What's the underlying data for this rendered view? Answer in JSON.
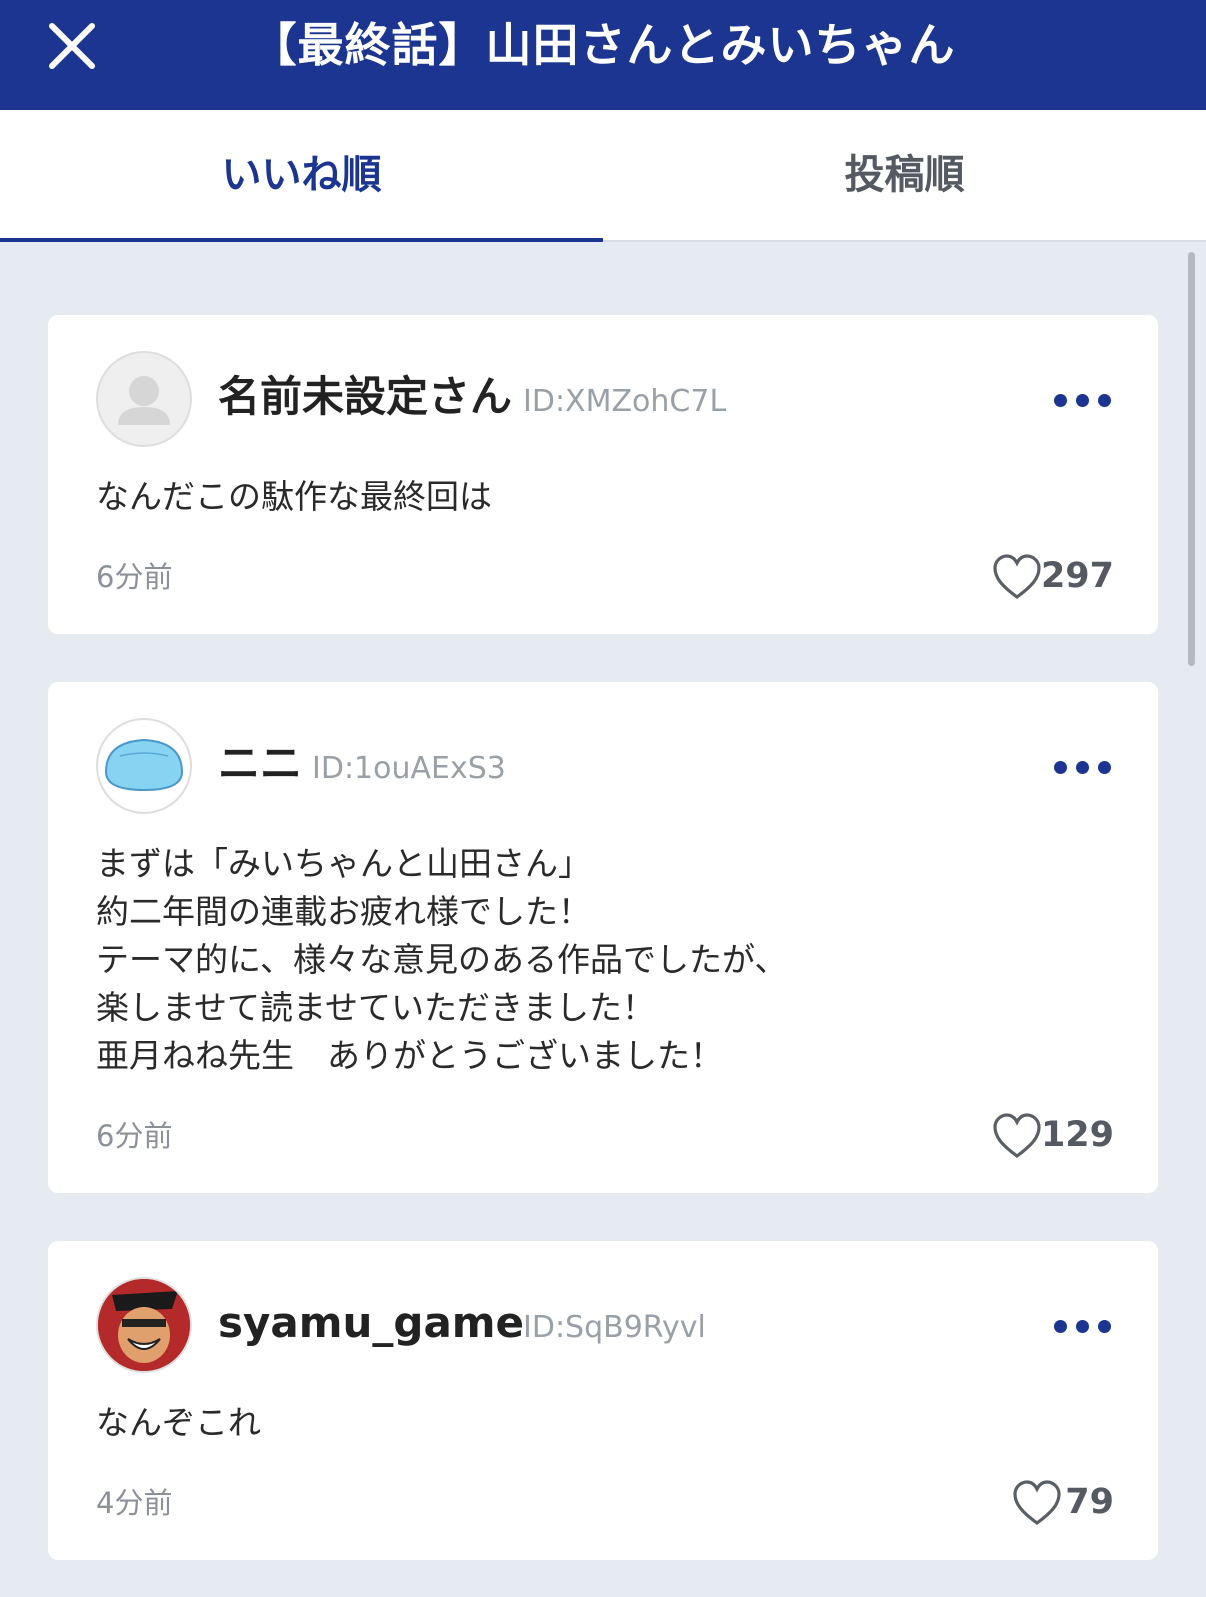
{
  "header": {
    "title": "【最終話】山田さんとみいちゃん",
    "close_icon": "close-icon"
  },
  "tabs": [
    {
      "label": "いいね順",
      "active": true
    },
    {
      "label": "投稿順",
      "active": false
    }
  ],
  "comments": [
    {
      "user_name": "名前未設定さん",
      "user_id": "ID:XMZohC7L",
      "avatar": "default-avatar-icon",
      "body": [
        "なんだこの駄作な最終回は"
      ],
      "time": "6分前",
      "likes": "297"
    },
    {
      "user_name": "ニニ",
      "user_id": "ID:1ouAExS3",
      "avatar": "slime-avatar-icon",
      "body": [
        "まずは「みいちゃんと山田さん」",
        "約二年間の連載お疲れ様でした！",
        "テーマ的に、様々な意見のある作品でしたが、",
        "楽しませて読ませていただきました！",
        "亜月ねね先生　ありがとうございました！"
      ],
      "time": "6分前",
      "likes": "129"
    },
    {
      "user_name": "syamu_game",
      "user_id": "ID:SqB9Ryvl",
      "avatar": "character-avatar-icon",
      "body": [
        "なんぞこれ"
      ],
      "time": "4分前",
      "likes": "79"
    }
  ],
  "colors": {
    "accent": "#1b3590",
    "background": "#e6ebf2",
    "card": "#ffffff"
  }
}
